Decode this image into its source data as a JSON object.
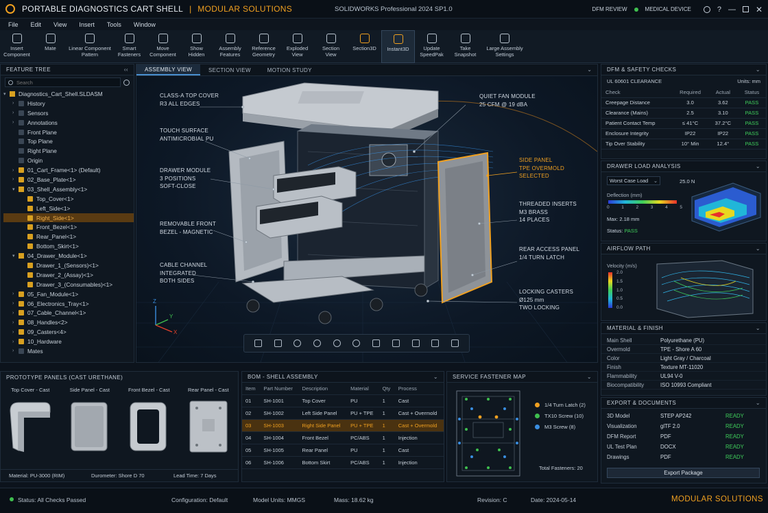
{
  "app": {
    "title": "PORTABLE DIAGNOSTICS CART SHELL",
    "separator": "|",
    "subtitle": "MODULAR SOLUTIONS",
    "software": "SOLIDWORKS Professional 2024 SP1.0",
    "badge_review": "DFM REVIEW",
    "badge_device": "MEDICAL DEVICE"
  },
  "menu": [
    "File",
    "Edit",
    "View",
    "Insert",
    "Tools",
    "Window"
  ],
  "toolbar": [
    {
      "label": "Insert\nComponent"
    },
    {
      "label": "Mate"
    },
    {
      "label": "Linear Component\nPattern"
    },
    {
      "label": "Smart\nFasteners"
    },
    {
      "label": "Move\nComponent"
    },
    {
      "label": "Show\nHidden"
    },
    {
      "label": "Assembly\nFeatures"
    },
    {
      "label": "Reference\nGeometry"
    },
    {
      "label": "Exploded\nView"
    },
    {
      "label": "Section\nView"
    },
    {
      "label": "Section3D"
    },
    {
      "label": "Instant3D"
    },
    {
      "label": "Update\nSpeedPak"
    },
    {
      "label": "Take\nSnapshot"
    },
    {
      "label": "Large Assembly\nSettings"
    }
  ],
  "feature_tree": {
    "title": "FEATURE TREE",
    "search_placeholder": "Search",
    "items": [
      {
        "label": "Diagnostics_Cart_Shell.SLDASM",
        "indent": 0,
        "arrow": "▾",
        "type": "asm"
      },
      {
        "label": "History",
        "indent": 1,
        "arrow": "›",
        "type": "gen"
      },
      {
        "label": "Sensors",
        "indent": 1,
        "arrow": "›",
        "type": "gen"
      },
      {
        "label": "Annotations",
        "indent": 1,
        "arrow": "›",
        "type": "gen"
      },
      {
        "label": "Front Plane",
        "indent": 1,
        "arrow": "",
        "type": "gen"
      },
      {
        "label": "Top Plane",
        "indent": 1,
        "arrow": "",
        "type": "gen"
      },
      {
        "label": "Right Plane",
        "indent": 1,
        "arrow": "",
        "type": "gen"
      },
      {
        "label": "Origin",
        "indent": 1,
        "arrow": "",
        "type": "gen"
      },
      {
        "label": "01_Cart_Frame<1> (Default)",
        "indent": 1,
        "arrow": "›",
        "type": "part"
      },
      {
        "label": "02_Base_Plate<1>",
        "indent": 1,
        "arrow": "›",
        "type": "part"
      },
      {
        "label": "03_Shell_Assembly<1>",
        "indent": 1,
        "arrow": "▾",
        "type": "asm"
      },
      {
        "label": "Top_Cover<1>",
        "indent": 2,
        "arrow": "",
        "type": "part"
      },
      {
        "label": "Left_Side<1>",
        "indent": 2,
        "arrow": "",
        "type": "part"
      },
      {
        "label": "Right_Side<1>",
        "indent": 2,
        "arrow": "",
        "type": "part",
        "selected": true
      },
      {
        "label": "Front_Bezel<1>",
        "indent": 2,
        "arrow": "",
        "type": "part"
      },
      {
        "label": "Rear_Panel<1>",
        "indent": 2,
        "arrow": "",
        "type": "part"
      },
      {
        "label": "Bottom_Skirt<1>",
        "indent": 2,
        "arrow": "",
        "type": "part"
      },
      {
        "label": "04_Drawer_Module<1>",
        "indent": 1,
        "arrow": "▾",
        "type": "asm"
      },
      {
        "label": "Drawer_1_(Sensors)<1>",
        "indent": 2,
        "arrow": "",
        "type": "part"
      },
      {
        "label": "Drawer_2_(Assay)<1>",
        "indent": 2,
        "arrow": "",
        "type": "part"
      },
      {
        "label": "Drawer_3_(Consumables)<1>",
        "indent": 2,
        "arrow": "",
        "type": "part"
      },
      {
        "label": "05_Fan_Module<1>",
        "indent": 1,
        "arrow": "›",
        "type": "part"
      },
      {
        "label": "06_Electronics_Tray<1>",
        "indent": 1,
        "arrow": "›",
        "type": "part"
      },
      {
        "label": "07_Cable_Channel<1>",
        "indent": 1,
        "arrow": "›",
        "type": "part"
      },
      {
        "label": "08_Handles<2>",
        "indent": 1,
        "arrow": "›",
        "type": "part"
      },
      {
        "label": "09_Casters<4>",
        "indent": 1,
        "arrow": "›",
        "type": "part"
      },
      {
        "label": "10_Hardware",
        "indent": 1,
        "arrow": "›",
        "type": "part"
      },
      {
        "label": "Mates",
        "indent": 1,
        "arrow": "›",
        "type": "gen"
      }
    ]
  },
  "viewport": {
    "tabs": [
      "ASSEMBLY VIEW",
      "SECTION VIEW",
      "MOTION STUDY"
    ],
    "callouts": {
      "top_cover": [
        "CLASS-A TOP COVER",
        "R3 ALL EDGES"
      ],
      "touch": [
        "TOUCH SURFACE",
        "ANTIMICROBIAL PU"
      ],
      "drawer": [
        "DRAWER MODULE",
        "3 POSITIONS",
        "SOFT-CLOSE"
      ],
      "bezel": [
        "REMOVABLE FRONT",
        "BEZEL - MAGNETIC"
      ],
      "cable": [
        "CABLE CHANNEL",
        "INTEGRATED",
        "BOTH SIDES"
      ],
      "fan": [
        "QUIET FAN MODULE",
        "25 CFM @ 19 dBA"
      ],
      "side": [
        "SIDE PANEL",
        "TPE OVERMOLD",
        "SELECTED"
      ],
      "inserts": [
        "THREADED INSERTS",
        "M3 BRASS",
        "14 PLACES"
      ],
      "rear": [
        "REAR ACCESS PANEL",
        "1/4 TURN LATCH"
      ],
      "casters": [
        "LOCKING CASTERS",
        "Ø125 mm",
        "TWO LOCKING"
      ]
    },
    "axes": {
      "z": "Z",
      "y": "Y",
      "x": "X"
    }
  },
  "dfm": {
    "title": "DFM & SAFETY CHECKS",
    "standard": "UL 60601 CLEARANCE",
    "units": "Units: mm",
    "headers": [
      "Check",
      "Required",
      "Actual",
      "Status"
    ],
    "rows": [
      [
        "Creepage Distance",
        "3.0",
        "3.62",
        "PASS"
      ],
      [
        "Clearance (Mains)",
        "2.5",
        "3.10",
        "PASS"
      ],
      [
        "Patient Contact Temp",
        "≤ 41°C",
        "37.2°C",
        "PASS"
      ],
      [
        "Enclosure Integrity",
        "IP22",
        "IP22",
        "PASS"
      ],
      [
        "Tip Over Stability",
        "10° Min",
        "12.4°",
        "PASS"
      ]
    ]
  },
  "drawer_load": {
    "title": "DRAWER LOAD ANALYSIS",
    "case": "Worst Case Load",
    "load": "25.0 N",
    "deflection_label": "Deflection (mm)",
    "scale": [
      "0",
      "1",
      "2",
      "3",
      "4",
      "5"
    ],
    "max": "Max: 2.18 mm",
    "status_label": "Status:",
    "status": "PASS"
  },
  "airflow": {
    "title": "AIRFLOW PATH",
    "label": "Velocity (m/s)",
    "scale": [
      "2.0",
      "1.5",
      "1.0",
      "0.5",
      "0.0"
    ]
  },
  "material": {
    "title": "MATERIAL & FINISH",
    "rows": [
      [
        "Main Shell",
        "Polyurethane (PU)"
      ],
      [
        "Overmold",
        "TPE - Shore A 60"
      ],
      [
        "Color",
        "Light Gray / Charcoal"
      ],
      [
        "Finish",
        "Texture MT-11020"
      ],
      [
        "Flammability",
        "UL94 V-0"
      ],
      [
        "Biocompatibility",
        "ISO 10993 Compliant"
      ]
    ]
  },
  "exports": {
    "title": "EXPORT & DOCUMENTS",
    "rows": [
      [
        "3D Model",
        "STEP AP242",
        "READY"
      ],
      [
        "Visualization",
        "glTF 2.0",
        "READY"
      ],
      [
        "DFM Report",
        "PDF",
        "READY"
      ],
      [
        "UL Test Plan",
        "DOCX",
        "READY"
      ],
      [
        "Drawings",
        "PDF",
        "READY"
      ]
    ],
    "button": "Export Package"
  },
  "prototypes": {
    "title": "PROTOTYPE PANELS (CAST URETHANE)",
    "items": [
      "Top Cover - Cast",
      "Side Panel - Cast",
      "Front Bezel - Cast",
      "Rear Panel - Cast"
    ],
    "material": "Material:  PU-3000 (RIM)",
    "durometer": "Durometer:  Shore D 70",
    "lead": "Lead Time:  7 Days"
  },
  "bom": {
    "title": "BOM - SHELL ASSEMBLY",
    "headers": [
      "Item",
      "Part Number",
      "Description",
      "Material",
      "Qty",
      "Process"
    ],
    "rows": [
      [
        "01",
        "SH-1001",
        "Top Cover",
        "PU",
        "1",
        "Cast"
      ],
      [
        "02",
        "SH-1002",
        "Left Side Panel",
        "PU + TPE",
        "1",
        "Cast + Overmold"
      ],
      [
        "03",
        "SH-1003",
        "Right Side Panel",
        "PU + TPE",
        "1",
        "Cast + Overmold"
      ],
      [
        "04",
        "SH-1004",
        "Front Bezel",
        "PC/ABS",
        "1",
        "Injection"
      ],
      [
        "05",
        "SH-1005",
        "Rear Panel",
        "PU",
        "1",
        "Cast"
      ],
      [
        "06",
        "SH-1006",
        "Bottom Skirt",
        "PC/ABS",
        "1",
        "Injection"
      ]
    ]
  },
  "fasteners": {
    "title": "SERVICE FASTENER MAP",
    "legend": [
      {
        "label": "1/4 Turn Latch (2)",
        "color": "#f0a020"
      },
      {
        "label": "TX10 Screw (10)",
        "color": "#3fbf4f"
      },
      {
        "label": "M3 Screw (8)",
        "color": "#3a8ee0"
      }
    ],
    "total": "Total Fasteners: 20"
  },
  "status": {
    "state": "Status:  All Checks Passed",
    "config": "Configuration:  Default",
    "units": "Model Units:  MMGS",
    "mass": "Mass:  18.62 kg",
    "revision": "Revision:  C",
    "date": "Date:  2024-05-14",
    "brand": "MODULAR SOLUTIONS"
  }
}
